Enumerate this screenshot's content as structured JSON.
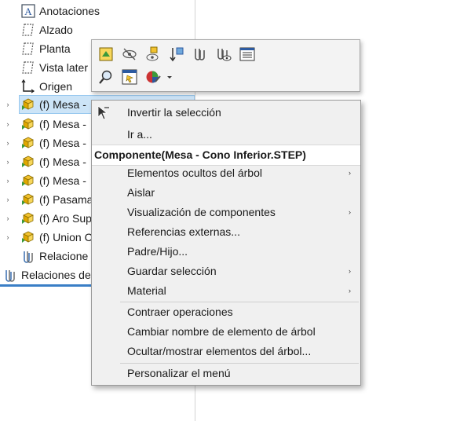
{
  "tree": {
    "items": [
      {
        "label": "Anotaciones",
        "icon": "annotations-icon"
      },
      {
        "label": "Alzado",
        "icon": "plane-icon"
      },
      {
        "label": "Planta",
        "icon": "plane-icon"
      },
      {
        "label": "Vista later",
        "icon": "plane-icon"
      },
      {
        "label": "Origen",
        "icon": "origin-icon"
      },
      {
        "label": "(f) Mesa -",
        "icon": "component-icon",
        "expander": "›"
      },
      {
        "label": "(f) Mesa -",
        "icon": "component-icon",
        "expander": "›"
      },
      {
        "label": "(f) Mesa -",
        "icon": "component-icon",
        "expander": "›"
      },
      {
        "label": "(f) Mesa -",
        "icon": "component-icon",
        "expander": "›"
      },
      {
        "label": "(f) Mesa -",
        "icon": "component-icon",
        "expander": "›"
      },
      {
        "label": "(f) Pasama",
        "icon": "component-icon",
        "expander": "›"
      },
      {
        "label": "(f) Aro Sup",
        "icon": "component-icon",
        "expander": "›"
      },
      {
        "label": "(f) Union C",
        "icon": "component-icon",
        "expander": "›"
      },
      {
        "label": "Relacione",
        "icon": "mates-icon"
      },
      {
        "label": "Relaciones de",
        "icon": "mates-icon"
      }
    ]
  },
  "toolbar": {
    "row1": [
      "open-part-icon",
      "hide-icon",
      "show-components-icon",
      "sort-icon",
      "mates-icon",
      "view-mates-icon",
      "properties-icon"
    ],
    "row2": [
      "zoom-selection-icon",
      "select-toolbar-icon",
      "appearance-icon",
      "dropdown-arrow-icon"
    ]
  },
  "menu": {
    "invert_selection": "Invertir la selección",
    "go_to": "Ir a...",
    "component_header": "Componente(Mesa - Cono Inferior.STEP)",
    "hidden_tree_items": "Elementos ocultos del árbol",
    "isolate": "Aislar",
    "component_display": "Visualización de componentes",
    "external_references": "Referencias externas...",
    "parent_child": "Padre/Hijo...",
    "save_selection": "Guardar selección",
    "material": "Material",
    "collapse_features": "Contraer operaciones",
    "rename_tree_item": "Cambiar nombre de elemento de árbol",
    "hide_show_tree_items": "Ocultar/mostrar elementos del árbol...",
    "customize_menu": "Personalizar el menú",
    "submenu_arrow": "›"
  },
  "colors": {
    "selection_bg": "#cce4f7",
    "accent_blue": "#3a7ec6",
    "component_yellow": "#f2c230",
    "component_green": "#3b9a3b"
  }
}
